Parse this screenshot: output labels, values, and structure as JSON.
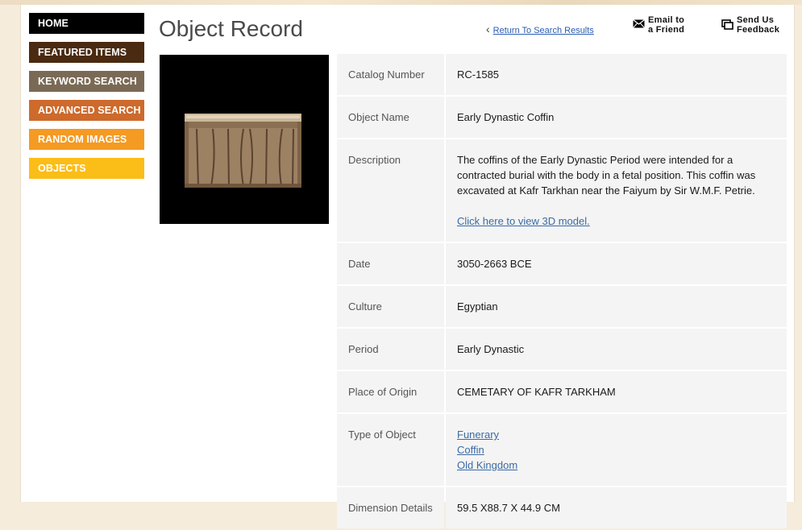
{
  "nav": {
    "items": [
      {
        "label": "HOME"
      },
      {
        "label": "FEATURED ITEMS"
      },
      {
        "label": "KEYWORD SEARCH"
      },
      {
        "label": "ADVANCED SEARCH"
      },
      {
        "label": "RANDOM IMAGES"
      },
      {
        "label": "OBJECTS"
      }
    ]
  },
  "header": {
    "title": "Object Record",
    "return_label": "Return To Search Results",
    "email_line1": "Email to",
    "email_line2": "a Friend",
    "feedback_line1": "Send Us",
    "feedback_line2": "Feedback"
  },
  "record": {
    "catalog_label": "Catalog Number",
    "catalog_value": "RC-1585",
    "name_label": "Object Name",
    "name_value": "Early Dynastic Coffin",
    "description_label": "Description",
    "description_value": "The coffins of the Early Dynastic Period were intended for a contracted burial with the body in a fetal position. This coffin was excavated at Kafr Tarkhan near the Faiyum by Sir W.M.F. Petrie.",
    "model_link": "Click here to view 3D model.",
    "date_label": "Date",
    "date_value": "3050-2663 BCE",
    "culture_label": "Culture",
    "culture_value": "Egyptian",
    "period_label": "Period",
    "period_value": "Early Dynastic",
    "origin_label": "Place of Origin",
    "origin_value": "CEMETARY OF KAFR TARKHAM",
    "type_label": "Type of Object",
    "type_values": [
      "Funerary",
      "Coffin",
      "Old Kingdom"
    ],
    "dimension_label": "Dimension Details",
    "dimension_value": "59.5 X88.7 X 44.9 CM"
  },
  "colors": {
    "home": "#000000",
    "featured": "#4a2a10",
    "keyword": "#7a6a55",
    "advanced": "#cd6a2c",
    "random": "#f59a22",
    "objects": "#fbbd18",
    "link": "#3b6aa3"
  },
  "icons": {
    "email": "envelope-icon",
    "feedback": "feedback-windows-icon",
    "return": "chevron-left-icon"
  }
}
